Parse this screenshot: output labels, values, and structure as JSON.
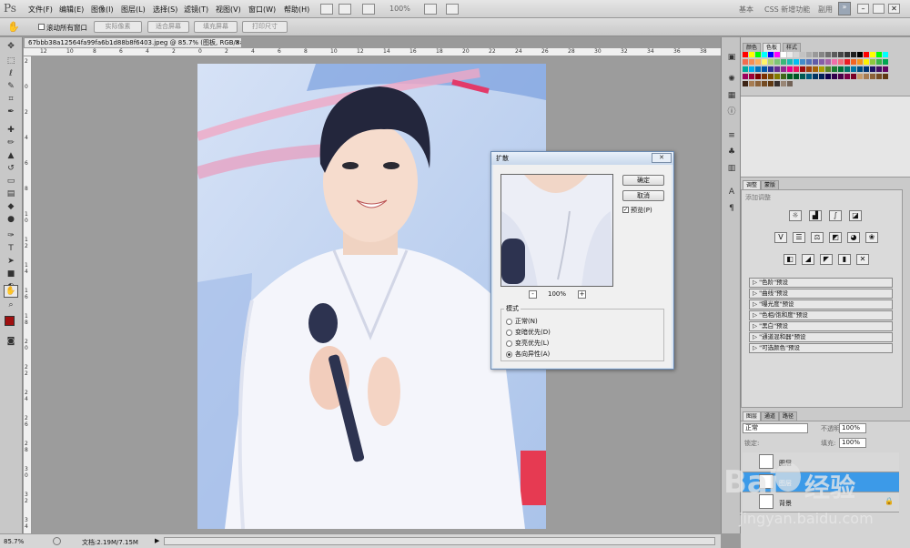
{
  "app": {
    "logo": "Ps"
  },
  "menu": [
    "文件(F)",
    "编辑(E)",
    "图像(I)",
    "图层(L)",
    "选择(S)",
    "滤镜(T)",
    "视图(V)",
    "窗口(W)",
    "帮助(H)"
  ],
  "menubar_right": {
    "zoom": "100%",
    "workspace": [
      "基本",
      "CSS 新增功能",
      "副用"
    ]
  },
  "options": {
    "scroll_all": "滚动所有窗口",
    "buttons": [
      "实际像素",
      "适合屏幕",
      "填充屏幕",
      "打印尺寸"
    ]
  },
  "document": {
    "tab_title": "67bbb38a12564fa99fa6b1d88b8f6403.jpeg @ 85.7% (图板, RGB/8#) *"
  },
  "ruler": {
    "top": [
      "12",
      "10",
      "8",
      "6",
      "4",
      "2",
      "0",
      "2",
      "4",
      "6",
      "8",
      "10",
      "12",
      "14",
      "16",
      "18",
      "20",
      "22",
      "24",
      "26",
      "28",
      "30",
      "32",
      "34",
      "36",
      "38"
    ],
    "left": [
      "2",
      "0",
      "2",
      "4",
      "6",
      "8",
      "1 0",
      "1 2",
      "1 4",
      "1 6",
      "1 8",
      "2 0",
      "2 2",
      "2 4",
      "2 6",
      "2 8",
      "3 0",
      "3 2",
      "3 4"
    ]
  },
  "status": {
    "zoom": "85.7%",
    "doc": "文档:2.19M/7.15M"
  },
  "dialog": {
    "title": "扩散",
    "close": "✕",
    "ok": "确定",
    "cancel": "取消",
    "preview_label": "预览(P)",
    "preview_checked": true,
    "zoom_minus": "-",
    "zoom_value": "100%",
    "zoom_plus": "+",
    "mode_group": "模式",
    "modes": [
      "正常(N)",
      "变暗优先(D)",
      "变亮优先(L)",
      "各向异性(A)"
    ],
    "selected_mode": 3
  },
  "panels": {
    "swatch_tabs": [
      "颜色",
      "色板",
      "样式"
    ],
    "adjust_tabs": [
      "调整",
      "蒙版"
    ],
    "adjust_hint": "添加调整",
    "presets": [
      "\"色阶\"预设",
      "\"曲线\"预设",
      "\"曝光度\"预设",
      "\"色相/饱和度\"预设",
      "\"黑白\"预设",
      "\"通道混和器\"预设",
      "\"可选颜色\"预设"
    ],
    "layer_tabs": [
      "图层",
      "通道",
      "路径"
    ],
    "blend_mode": "正常",
    "opacity_label": "不透明度:",
    "opacity": "100%",
    "lock_label": "锁定:",
    "fill_label": "填充:",
    "fill": "100%",
    "layers": [
      "图层",
      "图层",
      "背景"
    ]
  },
  "watermark": {
    "brand": "Bai",
    "brand2": "经验",
    "url": "jingyan.baidu.com"
  },
  "colors": {
    "accent": "#3c8fe6",
    "fg_swatch": "#a01010",
    "selected_layer": "#3c9ae8"
  }
}
